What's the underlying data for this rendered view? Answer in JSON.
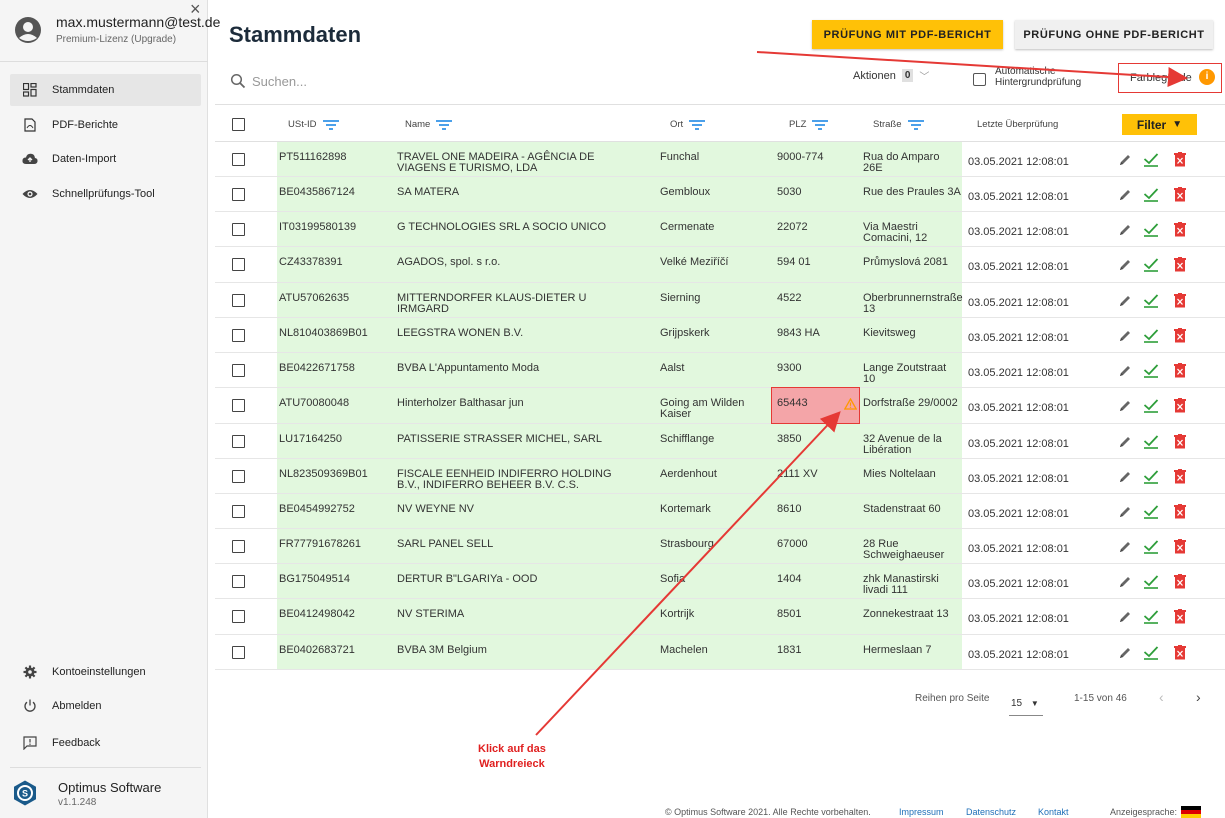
{
  "user": {
    "email": "max.mustermann@test.de",
    "license": "Premium-Lizenz (Upgrade)"
  },
  "sidebar": {
    "items": [
      {
        "label": "Stammdaten",
        "icon": "dashboard-icon",
        "active": true
      },
      {
        "label": "PDF-Berichte",
        "icon": "pdf-icon"
      },
      {
        "label": "Daten-Import",
        "icon": "cloud-upload-icon"
      },
      {
        "label": "Schnellprüfungs-Tool",
        "icon": "eye-icon"
      }
    ],
    "bottom_items": [
      {
        "label": "Kontoeinstellungen",
        "icon": "gear-icon"
      },
      {
        "label": "Abmelden",
        "icon": "power-icon"
      },
      {
        "label": "Feedback",
        "icon": "feedback-icon"
      }
    ],
    "brand": {
      "name": "Optimus Software",
      "version": "v1.1.248"
    }
  },
  "header": {
    "title": "Stammdaten",
    "btn_pdf": "PRÜFUNG MIT PDF-BERICHT",
    "btn_nopdf": "PRÜFUNG OHNE PDF-BERICHT",
    "search_placeholder": "Suchen...",
    "actions_label": "Aktionen",
    "actions_count": "0",
    "auto_check_label": "Automatische Hintergrundprüfung",
    "legend_label": "Farblegende",
    "legend_info": "i"
  },
  "table": {
    "columns": [
      "USt-ID",
      "Name",
      "Ort",
      "PLZ",
      "Straße",
      "Letzte Überprüfung"
    ],
    "filter_label": "Filter",
    "rows": [
      {
        "ustid": "PT511162898",
        "name": "TRAVEL ONE MADEIRA - AGÊNCIA DE VIAGENS E TURISMO, LDA",
        "ort": "Funchal",
        "plz": "9000-774",
        "strasse": "Rua do Amparo 26E",
        "date": "03.05.2021 12:08:01"
      },
      {
        "ustid": "BE0435867124",
        "name": "SA MATERA",
        "ort": "Gembloux",
        "plz": "5030",
        "strasse": "Rue des Praules 3A",
        "date": "03.05.2021 12:08:01"
      },
      {
        "ustid": "IT03199580139",
        "name": "G TECHNOLOGIES SRL A SOCIO UNICO",
        "ort": "Cermenate",
        "plz": "22072",
        "strasse": "Via Maestri Comacini, 12",
        "date": "03.05.2021 12:08:01"
      },
      {
        "ustid": "CZ43378391",
        "name": "AGADOS, spol. s r.o.",
        "ort": "Velké Meziříčí",
        "plz": "594 01",
        "strasse": "Průmyslová 2081",
        "date": "03.05.2021 12:08:01"
      },
      {
        "ustid": "ATU57062635",
        "name": "MITTERNDORFER KLAUS-DIETER U IRMGARD",
        "ort": "Sierning",
        "plz": "4522",
        "strasse": "Oberbrunnernstraße 13",
        "date": "03.05.2021 12:08:01"
      },
      {
        "ustid": "NL810403869B01",
        "name": "LEEGSTRA WONEN B.V.",
        "ort": "Grijpskerk",
        "plz": "9843 HA",
        "strasse": "Kievitsweg",
        "date": "03.05.2021 12:08:01"
      },
      {
        "ustid": "BE0422671758",
        "name": "BVBA L'Appuntamento Moda",
        "ort": "Aalst",
        "plz": "9300",
        "strasse": "Lange Zoutstraat 10",
        "date": "03.05.2021 12:08:01"
      },
      {
        "ustid": "ATU70080048",
        "name": "Hinterholzer Balthasar jun",
        "ort": "Going am Wilden Kaiser",
        "plz": "65443",
        "strasse": "Dorfstraße 29/0002",
        "date": "03.05.2021 12:08:01",
        "warn": true
      },
      {
        "ustid": "LU17164250",
        "name": "PATISSERIE STRASSER MICHEL, SARL",
        "ort": "Schifflange",
        "plz": "3850",
        "strasse": "32 Avenue de la Libération",
        "date": "03.05.2021 12:08:01"
      },
      {
        "ustid": "NL823509369B01",
        "name": "FISCALE EENHEID INDIFERRO HOLDING B.V., INDIFERRO BEHEER B.V. C.S.",
        "ort": "Aerdenhout",
        "plz": "2111 XV",
        "strasse": "Mies Noltelaan",
        "date": "03.05.2021 12:08:01"
      },
      {
        "ustid": "BE0454992752",
        "name": "NV WEYNE NV",
        "ort": "Kortemark",
        "plz": "8610",
        "strasse": "Stadenstraat 60",
        "date": "03.05.2021 12:08:01"
      },
      {
        "ustid": "FR77791678261",
        "name": "SARL PANEL SELL",
        "ort": "Strasbourg",
        "plz": "67000",
        "strasse": "28 Rue Schweighaeuser",
        "date": "03.05.2021 12:08:01"
      },
      {
        "ustid": "BG175049514",
        "name": "DERTUR B\"LGARIYa - OOD",
        "ort": "Sofia",
        "plz": "1404",
        "strasse": "zhk Manastirski livadi 111",
        "date": "03.05.2021 12:08:01"
      },
      {
        "ustid": "BE0412498042",
        "name": "NV STERIMA",
        "ort": "Kortrijk",
        "plz": "8501",
        "strasse": "Zonnekestraat 13",
        "date": "03.05.2021 12:08:01"
      },
      {
        "ustid": "BE0402683721",
        "name": "BVBA 3M Belgium",
        "ort": "Machelen",
        "plz": "1831",
        "strasse": "Hermeslaan 7",
        "date": "03.05.2021 12:08:01"
      }
    ]
  },
  "pagination": {
    "rows_per_page_label": "Reihen pro Seite",
    "rows_per_page": "15",
    "range": "1-15 von 46",
    "prev": "‹",
    "next": "›"
  },
  "footer": {
    "copyright": "© Optimus Software 2021. Alle Rechte vorbehalten.",
    "impressum": "Impressum",
    "datenschutz": "Datenschutz",
    "kontakt": "Kontakt",
    "language_label": "Anzeigesprache:"
  },
  "annotation": {
    "line1": "Klick auf das",
    "line2": "Warndreieck"
  },
  "colors": {
    "accent": "#ffc107",
    "valid_bg": "#e2f8de",
    "warn_bg": "#f4a5a8",
    "annotation": "#e53935",
    "check": "#2e9e3a",
    "delete": "#e53935"
  }
}
